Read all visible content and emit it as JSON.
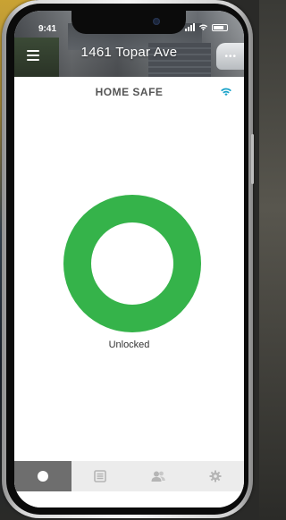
{
  "status_bar": {
    "time": "9:41"
  },
  "header": {
    "address": "1461 Topar Ave",
    "menu_icon": "hamburger-icon",
    "more_icon": "more-dots-icon"
  },
  "main": {
    "title": "HOME SAFE",
    "wifi_icon": "wifi-icon",
    "lock_state": "Unlocked",
    "lock_color": "#35b34a"
  },
  "tabbar": {
    "tabs": [
      {
        "icon": "lock-status-icon",
        "active": true
      },
      {
        "icon": "history-icon",
        "active": false
      },
      {
        "icon": "users-icon",
        "active": false
      },
      {
        "icon": "settings-gear-icon",
        "active": false
      }
    ]
  },
  "colors": {
    "accent": "#1aa3c9",
    "tab_active": "#6e6e6e",
    "tab_inactive": "#ececec"
  }
}
